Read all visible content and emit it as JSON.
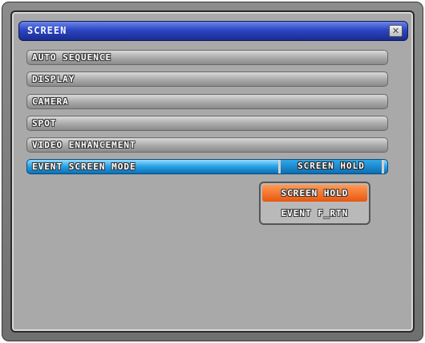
{
  "window": {
    "title": "SCREEN",
    "close_glyph": "✕"
  },
  "menu": {
    "items": [
      {
        "label": "AUTO SEQUENCE"
      },
      {
        "label": "DISPLAY"
      },
      {
        "label": "CAMERA"
      },
      {
        "label": "SPOT"
      },
      {
        "label": "VIDEO ENHANCEMENT"
      },
      {
        "label": "EVENT SCREEN MODE",
        "value": "SCREEN HOLD",
        "selected": true
      }
    ]
  },
  "dropdown": {
    "options": [
      {
        "label": "SCREEN HOLD",
        "highlighted": true
      },
      {
        "label": "EVENT F_RTN",
        "highlighted": false
      }
    ]
  },
  "colors": {
    "title_bar": "#2c45c4",
    "selected_item": "#2da5e8",
    "highlighted_option": "#f07428",
    "panel": "#a9a9a9"
  }
}
